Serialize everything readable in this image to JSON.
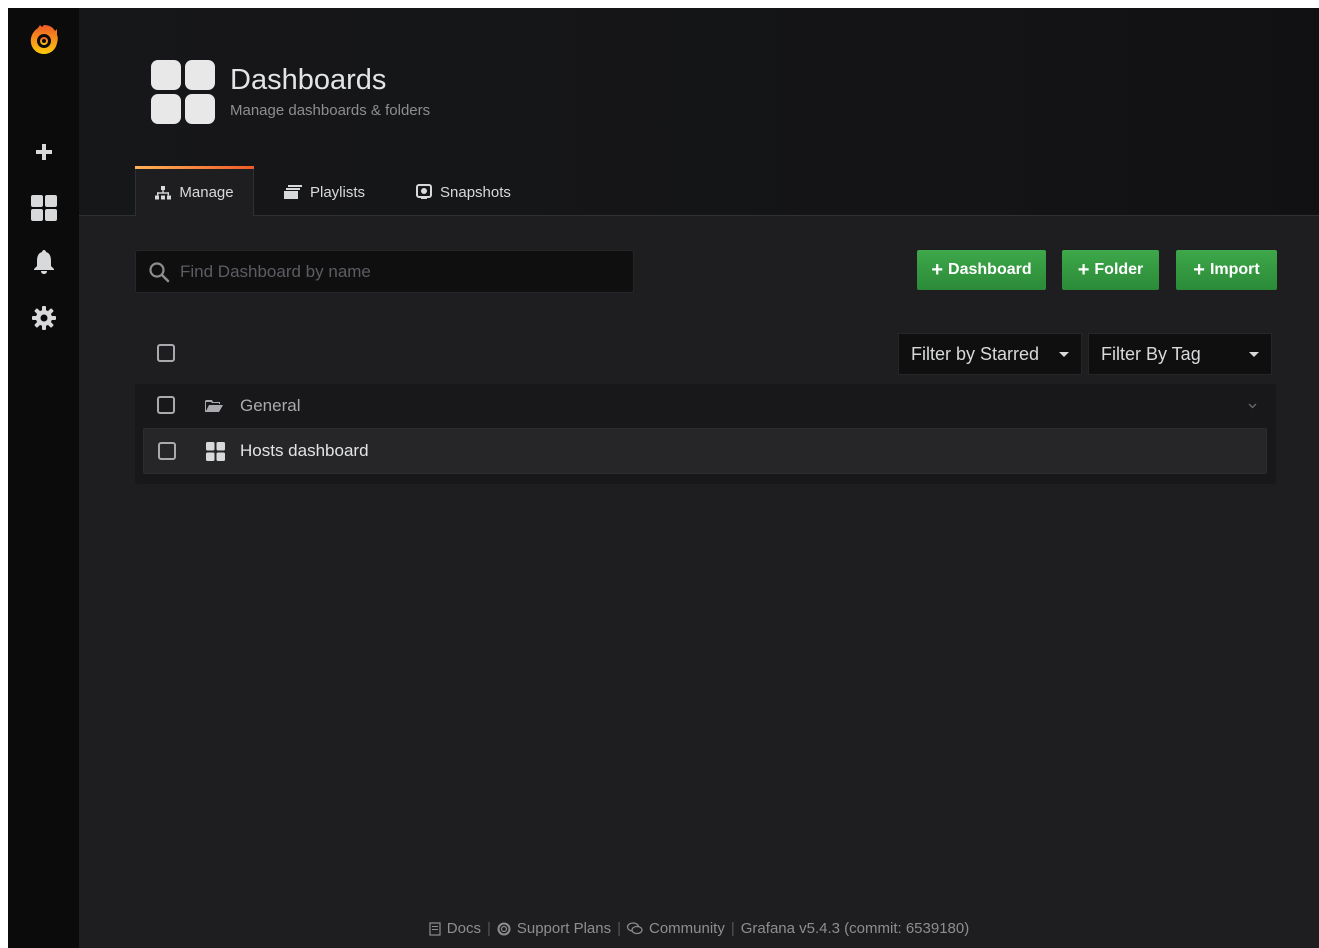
{
  "header": {
    "title": "Dashboards",
    "subtitle": "Manage dashboards & folders"
  },
  "tabs": [
    {
      "label": "Manage",
      "icon": "sitemap-icon",
      "active": true
    },
    {
      "label": "Playlists",
      "icon": "playlist-icon",
      "active": false
    },
    {
      "label": "Snapshots",
      "icon": "snapshot-icon",
      "active": false
    }
  ],
  "search": {
    "placeholder": "Find Dashboard by name",
    "value": ""
  },
  "actions": {
    "dashboard_label": "Dashboard",
    "folder_label": "Folder",
    "import_label": "Import"
  },
  "filters": {
    "starred_label": "Filter by Starred",
    "tag_label": "Filter By Tag"
  },
  "list": {
    "folder": {
      "name": "General",
      "icon": "folder-open-icon"
    },
    "items": [
      {
        "name": "Hosts dashboard",
        "icon": "dashboard-grid-icon"
      }
    ]
  },
  "footer": {
    "docs": "Docs",
    "support": "Support Plans",
    "community": "Community",
    "version": "Grafana v5.4.3 (commit: 6539180)"
  },
  "colors": {
    "accent_green": "#3ea84a",
    "brand_orange": "#f05a28",
    "background": "#1e1e21",
    "sidebar": "#0b0b0c"
  }
}
